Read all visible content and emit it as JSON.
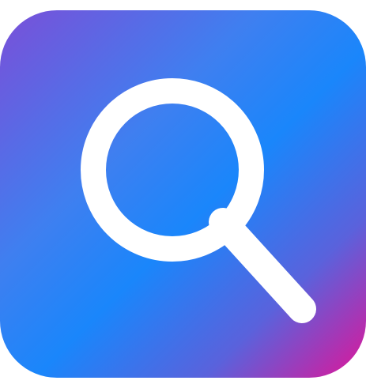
{
  "app_icon": {
    "icon": "search-icon",
    "colors": {
      "gradient_start": "#7a4fd8",
      "gradient_mid": "#1a86fb",
      "gradient_end": "#e01598",
      "glyph": "#ffffff",
      "background": "#ffffff"
    }
  }
}
